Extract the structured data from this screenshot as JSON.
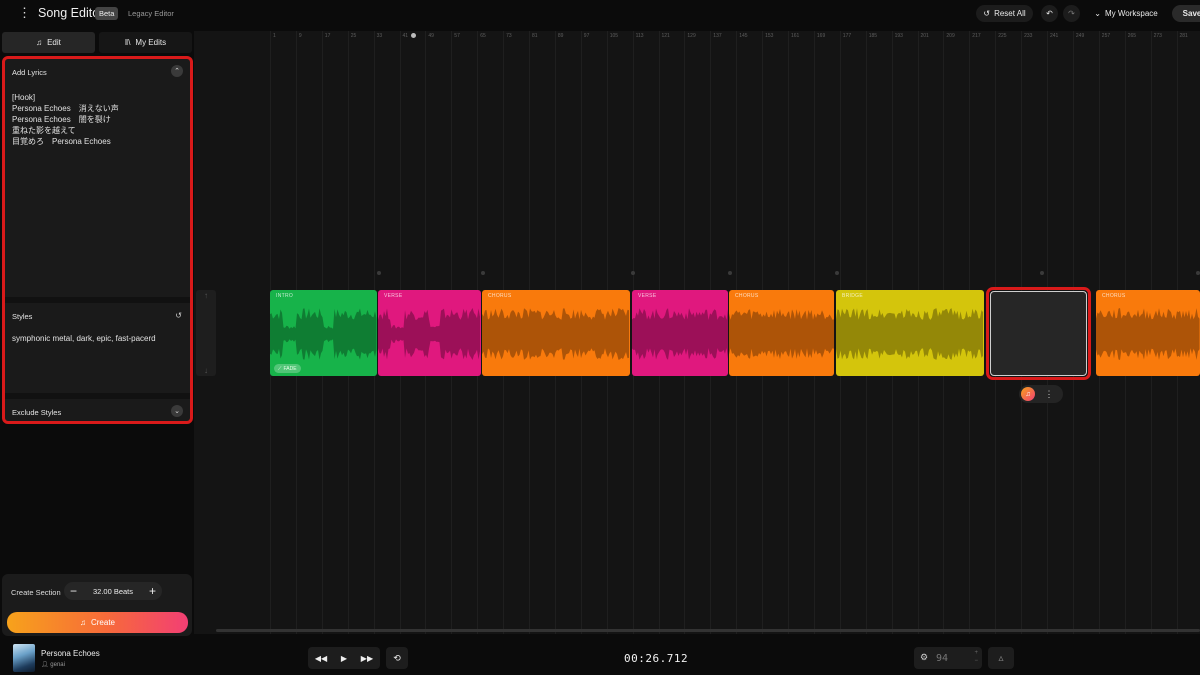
{
  "header": {
    "menu_icon": "more-vertical-icon",
    "title": "Song Editor",
    "badge": "Beta",
    "legacy_link": "Legacy Editor",
    "reset_all": "Reset All",
    "workspace": "My Workspace",
    "save": "Save"
  },
  "tabs": {
    "edit": "Edit",
    "my_edits": "My Edits"
  },
  "panel": {
    "lyrics_heading": "Add Lyrics",
    "lyrics_lines": [
      "[Hook]",
      "Persona Echoes　消えない声",
      "Persona Echoes　闇を裂け",
      "重ねた影を越えて",
      "目覚めろ　Persona Echoes"
    ],
    "styles_heading": "Styles",
    "styles_value": "symphonic metal, dark, epic, fast-pacerd",
    "exclude_heading": "Exclude Styles"
  },
  "create": {
    "label": "Create Section",
    "beats": "32.00 Beats",
    "button": "Create"
  },
  "timeline": {
    "ticks": [
      "1",
      "9",
      "17",
      "25",
      "33",
      "41",
      "49",
      "57",
      "65",
      "73",
      "81",
      "89",
      "97",
      "105",
      "113",
      "121",
      "129",
      "137",
      "145",
      "153",
      "161",
      "169",
      "177",
      "185",
      "193",
      "201",
      "209",
      "217",
      "225",
      "233",
      "241",
      "249",
      "257",
      "265",
      "273",
      "281"
    ],
    "sections": [
      {
        "label": "INTRO",
        "color": "#17b34a",
        "wave": "#0f7d33"
      },
      {
        "label": "VERSE",
        "color": "#e0187e",
        "wave": "#9c1058"
      },
      {
        "label": "CHORUS",
        "color": "#f97a0c",
        "wave": "#ad5408"
      },
      {
        "label": "VERSE",
        "color": "#e0187e",
        "wave": "#9c1058"
      },
      {
        "label": "CHORUS",
        "color": "#f97a0c",
        "wave": "#ad5408"
      },
      {
        "label": "BRIDGE",
        "color": "#d4c50c",
        "wave": "#948808"
      },
      {
        "label": "",
        "color": "#262626",
        "wave": "#262626"
      },
      {
        "label": "CHORUS",
        "color": "#f97a0c",
        "wave": "#ad5408"
      }
    ],
    "fade_chip": "FADE"
  },
  "player": {
    "track_title": "Persona Echoes",
    "track_artist": "genai",
    "time": "00:26.712",
    "tempo": "94"
  }
}
